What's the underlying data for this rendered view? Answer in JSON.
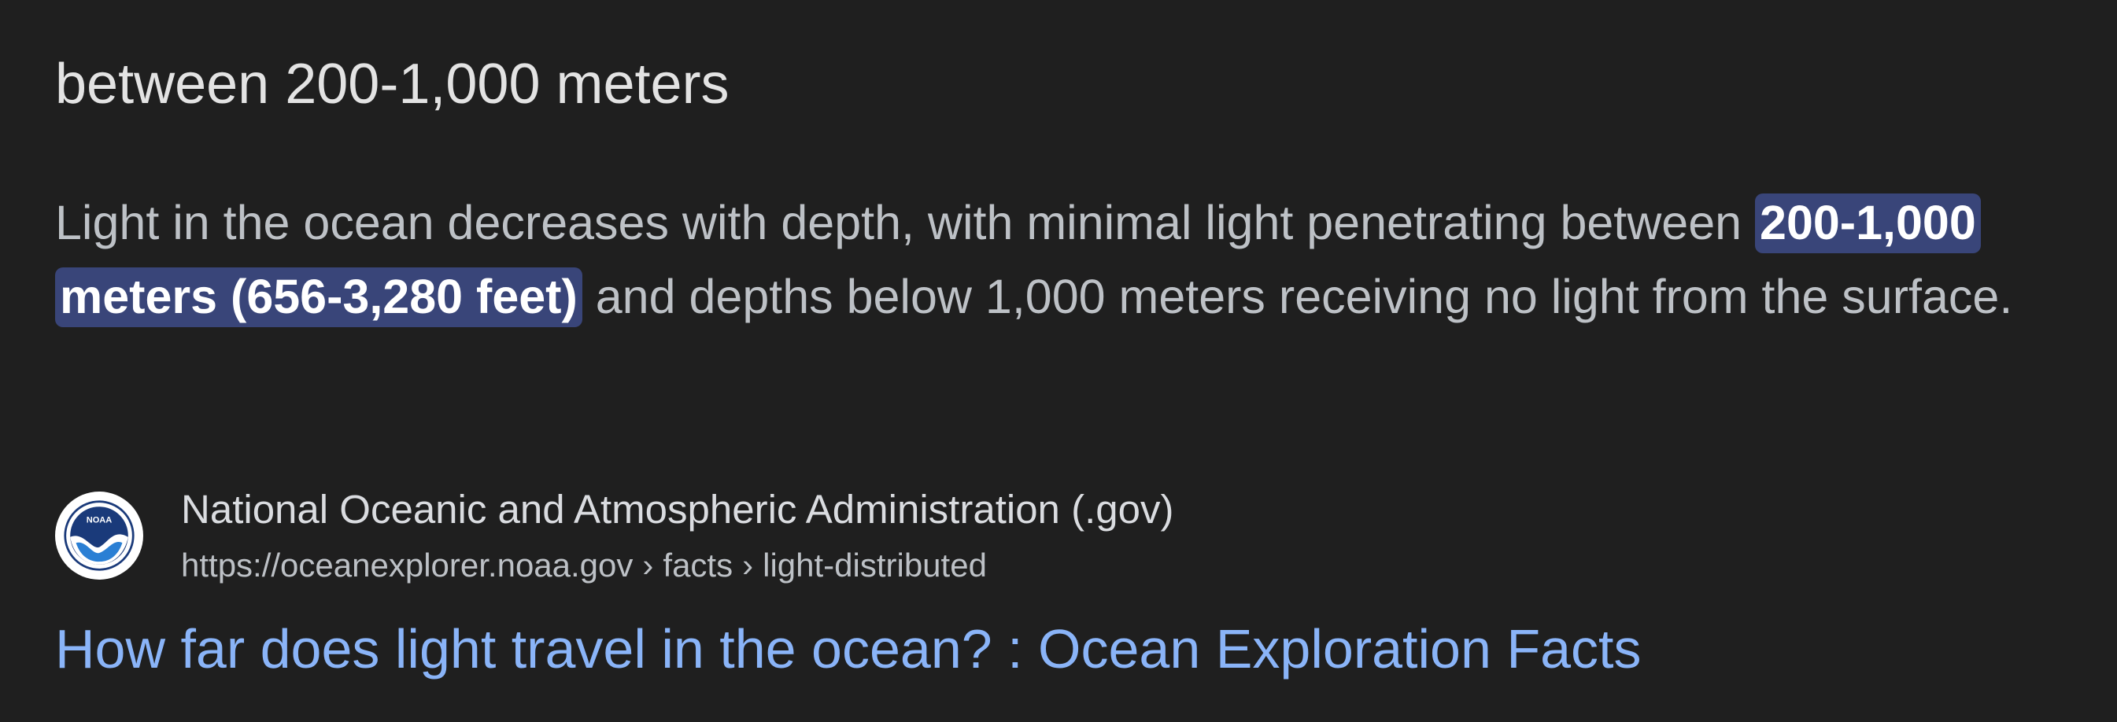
{
  "snippet": {
    "answer": "between 200-1,000 meters",
    "paragraph": {
      "before": "Light in the ocean decreases with depth, with minimal light penetrating between ",
      "highlight": "200-1,000 meters (656-3,280 feet)",
      "after": " and depths below 1,000 meters receiving no light from the surface."
    },
    "source": {
      "name": "National Oceanic and Atmospheric Administration (.gov)",
      "favicon": "noaa-logo-icon",
      "favicon_text": "NOAA",
      "breadcrumb": {
        "domain": "https://oceanexplorer.noaa.gov",
        "separator": "›",
        "path": [
          "facts",
          "light-distributed"
        ]
      }
    },
    "result_title": "How far does light travel in the ocean? : Ocean Exploration Facts"
  },
  "colors": {
    "background": "#1f1f1f",
    "highlight_background": "#394579",
    "link": "#8ab4f8",
    "text": "#bdc1c6",
    "answer": "#e3e3e3"
  }
}
